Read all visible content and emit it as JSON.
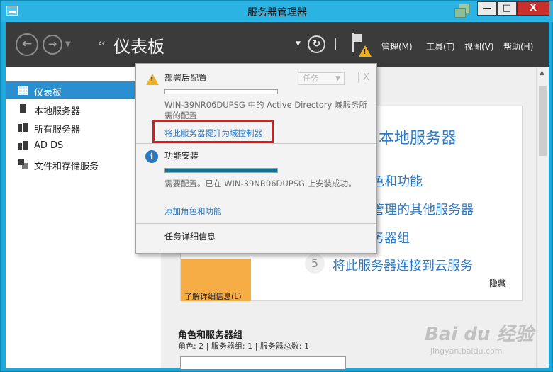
{
  "window": {
    "title": "服务器管理器",
    "min_label": "—",
    "max_label": "□",
    "close_label": "X"
  },
  "header": {
    "back_glyph": "←",
    "forward_glyph": "→",
    "breadcrumb_arrows": "‹‹",
    "page_title": "仪表板",
    "refresh_glyph": "↻",
    "menus": [
      "管理(M)",
      "工具(T)",
      "视图(V)",
      "帮助(H)"
    ]
  },
  "sidebar": {
    "items": [
      {
        "label": "仪表板",
        "icon": "dashboard-icon",
        "selected": true
      },
      {
        "label": "本地服务器",
        "icon": "server-icon",
        "selected": false
      },
      {
        "label": "所有服务器",
        "icon": "servers-icon",
        "selected": false
      },
      {
        "label": "AD DS",
        "icon": "ad-ds-icon",
        "selected": false
      },
      {
        "label": "文件和存储服务",
        "icon": "file-storage-icon",
        "selected": false
      }
    ]
  },
  "welcome": {
    "title_partial": "本地服务器",
    "link_roles_partial": "色和功能",
    "link_manage_partial": "管理的其他服务器",
    "link_group_partial": "务器组",
    "step_number": "5",
    "link_cloud": "将此服务器连接到云服务",
    "learn_more": "了解详细信息(L)",
    "hide": "隐藏"
  },
  "roles": {
    "title": "角色和服务器组",
    "summary": "角色: 2 | 服务器组: 1 | 服务器总数: 1"
  },
  "popup": {
    "section1_title": "部署后配置",
    "task_button": "任务",
    "close_glyph": "X",
    "section1_desc": "WIN-39NR06DUPSG 中的 Active Directory 域服务所需的配置",
    "promote_link": "将此服务器提升为域控制器",
    "section2_title": "功能安装",
    "install_progress": 1.0,
    "section2_desc": "需要配置。已在 WIN-39NR06DUPSG 上安装成功。",
    "add_roles_link": "添加角色和功能",
    "task_details": "任务详细信息"
  },
  "watermark": {
    "main": "Bai du 经验",
    "sub": "jingyan.baidu.com"
  },
  "colors": {
    "frame": "#1ba9dc",
    "header": "#3b3b3b",
    "accent": "#2b79c2",
    "selected": "#2a8fd1",
    "warning": "#f2b01e",
    "highlight": "#e01a1a",
    "progress": "#176f8f"
  }
}
